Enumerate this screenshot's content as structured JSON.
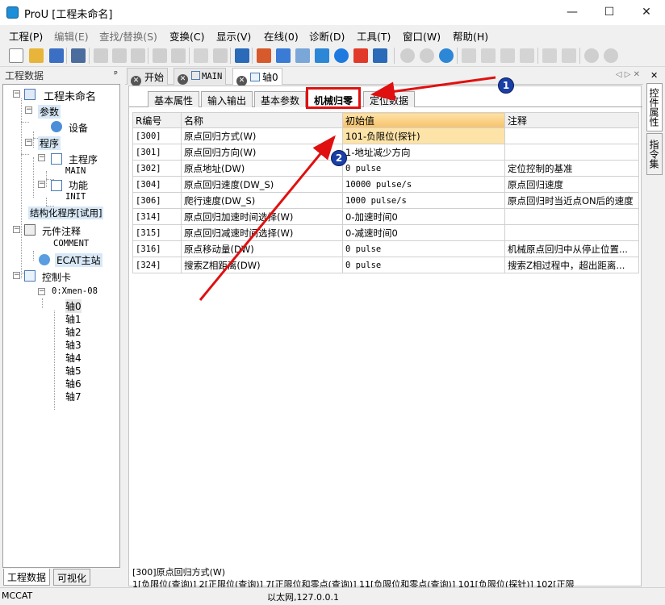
{
  "app": {
    "title": "ProU [工程未命名]"
  },
  "window": {
    "minimize": "—",
    "maximize": "☐",
    "close": "✕"
  },
  "menu": [
    {
      "label": "工程(P)",
      "disabled": false
    },
    {
      "label": "编辑(E)",
      "disabled": true
    },
    {
      "label": "查找/替换(S)",
      "disabled": true
    },
    {
      "label": "变换(C)",
      "disabled": false
    },
    {
      "label": "显示(V)",
      "disabled": false
    },
    {
      "label": "在线(0)",
      "disabled": false
    },
    {
      "label": "诊断(D)",
      "disabled": false
    },
    {
      "label": "工具(T)",
      "disabled": false
    },
    {
      "label": "窗口(W)",
      "disabled": false
    },
    {
      "label": "帮助(H)",
      "disabled": false
    }
  ],
  "left_panel": {
    "title": "工程数据",
    "pin": "ᵖ",
    "tree": {
      "root": "工程未命名",
      "params": "参数",
      "device": "设备",
      "program": "程序",
      "main_program": "主程序",
      "main": "MAIN",
      "function": "功能",
      "init": "INIT",
      "structured": "结构化程序[试用]",
      "annotation": "元件注释",
      "comment": "COMMENT",
      "ecat": "ECAT主站",
      "control_card": "控制卡",
      "xmen": "0:Xmen-08",
      "axes": [
        "轴0",
        "轴1",
        "轴2",
        "轴3",
        "轴4",
        "轴5",
        "轴6",
        "轴7"
      ]
    },
    "bottom_tabs": [
      "工程数据",
      "可视化"
    ]
  },
  "doc_tabs": [
    {
      "label": "开始",
      "active": false
    },
    {
      "label": "MAIN",
      "active": false
    },
    {
      "label": "轴0",
      "active": true
    }
  ],
  "sub_tabs": [
    "基本属性",
    "输入输出",
    "基本参数",
    "机械归零",
    "定位数据"
  ],
  "active_sub_tab": "机械归零",
  "table": {
    "headers": [
      "R编号",
      "名称",
      "初始值",
      "注释"
    ],
    "rows": [
      [
        "[300]",
        "原点回归方式(W)",
        "101-负限位(探针)",
        ""
      ],
      [
        "[301]",
        "原点回归方向(W)",
        "1-地址减少方向",
        ""
      ],
      [
        "[302]",
        "原点地址(DW)",
        "0 pulse",
        "定位控制的基准"
      ],
      [
        "[304]",
        "原点回归速度(DW_S)",
        "10000 pulse/s",
        "原点回归速度"
      ],
      [
        "[306]",
        "爬行速度(DW_S)",
        "1000 pulse/s",
        "原点回归时当近点ON后的速度"
      ],
      [
        "[314]",
        "原点回归加速时间选择(W)",
        "0-加速时间0",
        ""
      ],
      [
        "[315]",
        "原点回归减速时间选择(W)",
        "0-减速时间0",
        ""
      ],
      [
        "[316]",
        "原点移动量(DW)",
        "0 pulse",
        "机械原点回归中从停止位置..."
      ],
      [
        "[324]",
        "搜索Z相距离(DW)",
        "0 pulse",
        "搜索Z相过程中，超出距离..."
      ]
    ]
  },
  "description": {
    "line1": "[300]原点回归方式(W)",
    "line2": "1[负限位(查询)] 2[正限位(查询)] 7[正限位和零点(查询)] 11[负限位和零点(查询)] 101[负限位(探针)] 102[正限"
  },
  "right_panel": {
    "tabs": [
      "控件属性",
      "指令集"
    ],
    "close": "✕"
  },
  "status": {
    "left": "MCCAT",
    "center": "以太网,127.0.0.1"
  },
  "callouts": [
    "1",
    "2"
  ],
  "colors": {
    "highlight": "#fde3a7",
    "annotation_red": "#e01010",
    "callout_blue": "#1a3fa8"
  }
}
